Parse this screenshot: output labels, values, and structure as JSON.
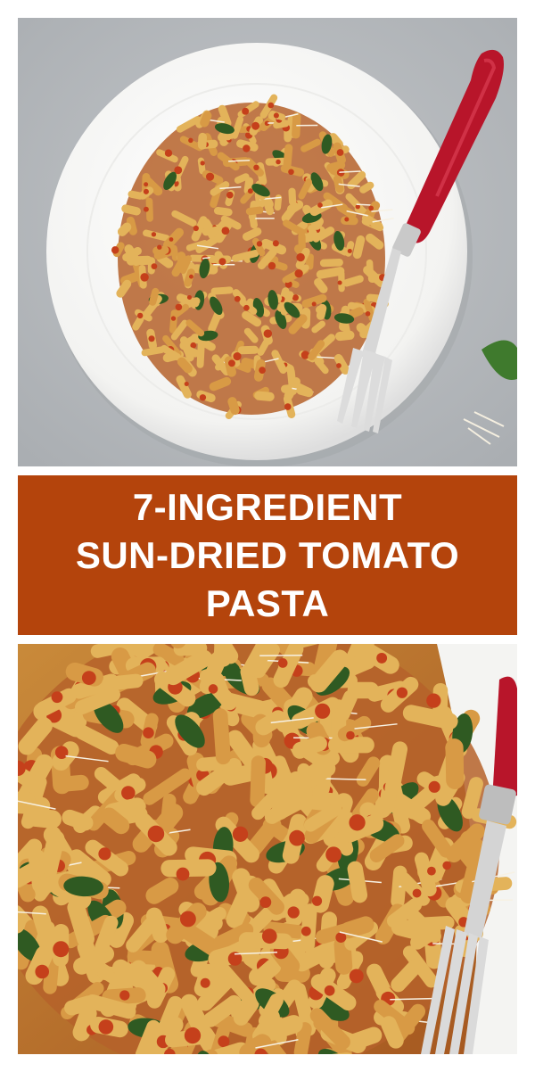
{
  "banner": {
    "lines": [
      "7-INGREDIENT",
      "SUN-DRIED TOMATO",
      "PASTA"
    ]
  },
  "photos": {
    "top": "plate-of-pasta-with-fork",
    "bottom": "pasta-closeup-with-fork"
  },
  "colors": {
    "banner_bg": "#b4440c",
    "banner_text": "#ffffff",
    "countertop": "#b9bcbf",
    "plate": "#f7f7f5",
    "pasta": "#e3b35a",
    "sauce": "#c5401b",
    "basil": "#2f5a22",
    "fork_handle": "#b8152a"
  }
}
